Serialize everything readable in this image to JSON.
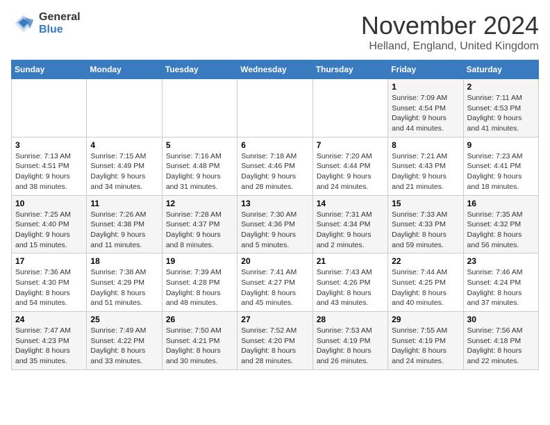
{
  "logo": {
    "general": "General",
    "blue": "Blue"
  },
  "title": "November 2024",
  "location": "Helland, England, United Kingdom",
  "days_of_week": [
    "Sunday",
    "Monday",
    "Tuesday",
    "Wednesday",
    "Thursday",
    "Friday",
    "Saturday"
  ],
  "weeks": [
    [
      {
        "day": "",
        "info": ""
      },
      {
        "day": "",
        "info": ""
      },
      {
        "day": "",
        "info": ""
      },
      {
        "day": "",
        "info": ""
      },
      {
        "day": "",
        "info": ""
      },
      {
        "day": "1",
        "info": "Sunrise: 7:09 AM\nSunset: 4:54 PM\nDaylight: 9 hours and 44 minutes."
      },
      {
        "day": "2",
        "info": "Sunrise: 7:11 AM\nSunset: 4:53 PM\nDaylight: 9 hours and 41 minutes."
      }
    ],
    [
      {
        "day": "3",
        "info": "Sunrise: 7:13 AM\nSunset: 4:51 PM\nDaylight: 9 hours and 38 minutes."
      },
      {
        "day": "4",
        "info": "Sunrise: 7:15 AM\nSunset: 4:49 PM\nDaylight: 9 hours and 34 minutes."
      },
      {
        "day": "5",
        "info": "Sunrise: 7:16 AM\nSunset: 4:48 PM\nDaylight: 9 hours and 31 minutes."
      },
      {
        "day": "6",
        "info": "Sunrise: 7:18 AM\nSunset: 4:46 PM\nDaylight: 9 hours and 28 minutes."
      },
      {
        "day": "7",
        "info": "Sunrise: 7:20 AM\nSunset: 4:44 PM\nDaylight: 9 hours and 24 minutes."
      },
      {
        "day": "8",
        "info": "Sunrise: 7:21 AM\nSunset: 4:43 PM\nDaylight: 9 hours and 21 minutes."
      },
      {
        "day": "9",
        "info": "Sunrise: 7:23 AM\nSunset: 4:41 PM\nDaylight: 9 hours and 18 minutes."
      }
    ],
    [
      {
        "day": "10",
        "info": "Sunrise: 7:25 AM\nSunset: 4:40 PM\nDaylight: 9 hours and 15 minutes."
      },
      {
        "day": "11",
        "info": "Sunrise: 7:26 AM\nSunset: 4:38 PM\nDaylight: 9 hours and 11 minutes."
      },
      {
        "day": "12",
        "info": "Sunrise: 7:28 AM\nSunset: 4:37 PM\nDaylight: 9 hours and 8 minutes."
      },
      {
        "day": "13",
        "info": "Sunrise: 7:30 AM\nSunset: 4:36 PM\nDaylight: 9 hours and 5 minutes."
      },
      {
        "day": "14",
        "info": "Sunrise: 7:31 AM\nSunset: 4:34 PM\nDaylight: 9 hours and 2 minutes."
      },
      {
        "day": "15",
        "info": "Sunrise: 7:33 AM\nSunset: 4:33 PM\nDaylight: 8 hours and 59 minutes."
      },
      {
        "day": "16",
        "info": "Sunrise: 7:35 AM\nSunset: 4:32 PM\nDaylight: 8 hours and 56 minutes."
      }
    ],
    [
      {
        "day": "17",
        "info": "Sunrise: 7:36 AM\nSunset: 4:30 PM\nDaylight: 8 hours and 54 minutes."
      },
      {
        "day": "18",
        "info": "Sunrise: 7:38 AM\nSunset: 4:29 PM\nDaylight: 8 hours and 51 minutes."
      },
      {
        "day": "19",
        "info": "Sunrise: 7:39 AM\nSunset: 4:28 PM\nDaylight: 8 hours and 48 minutes."
      },
      {
        "day": "20",
        "info": "Sunrise: 7:41 AM\nSunset: 4:27 PM\nDaylight: 8 hours and 45 minutes."
      },
      {
        "day": "21",
        "info": "Sunrise: 7:43 AM\nSunset: 4:26 PM\nDaylight: 8 hours and 43 minutes."
      },
      {
        "day": "22",
        "info": "Sunrise: 7:44 AM\nSunset: 4:25 PM\nDaylight: 8 hours and 40 minutes."
      },
      {
        "day": "23",
        "info": "Sunrise: 7:46 AM\nSunset: 4:24 PM\nDaylight: 8 hours and 37 minutes."
      }
    ],
    [
      {
        "day": "24",
        "info": "Sunrise: 7:47 AM\nSunset: 4:23 PM\nDaylight: 8 hours and 35 minutes."
      },
      {
        "day": "25",
        "info": "Sunrise: 7:49 AM\nSunset: 4:22 PM\nDaylight: 8 hours and 33 minutes."
      },
      {
        "day": "26",
        "info": "Sunrise: 7:50 AM\nSunset: 4:21 PM\nDaylight: 8 hours and 30 minutes."
      },
      {
        "day": "27",
        "info": "Sunrise: 7:52 AM\nSunset: 4:20 PM\nDaylight: 8 hours and 28 minutes."
      },
      {
        "day": "28",
        "info": "Sunrise: 7:53 AM\nSunset: 4:19 PM\nDaylight: 8 hours and 26 minutes."
      },
      {
        "day": "29",
        "info": "Sunrise: 7:55 AM\nSunset: 4:19 PM\nDaylight: 8 hours and 24 minutes."
      },
      {
        "day": "30",
        "info": "Sunrise: 7:56 AM\nSunset: 4:18 PM\nDaylight: 8 hours and 22 minutes."
      }
    ]
  ]
}
